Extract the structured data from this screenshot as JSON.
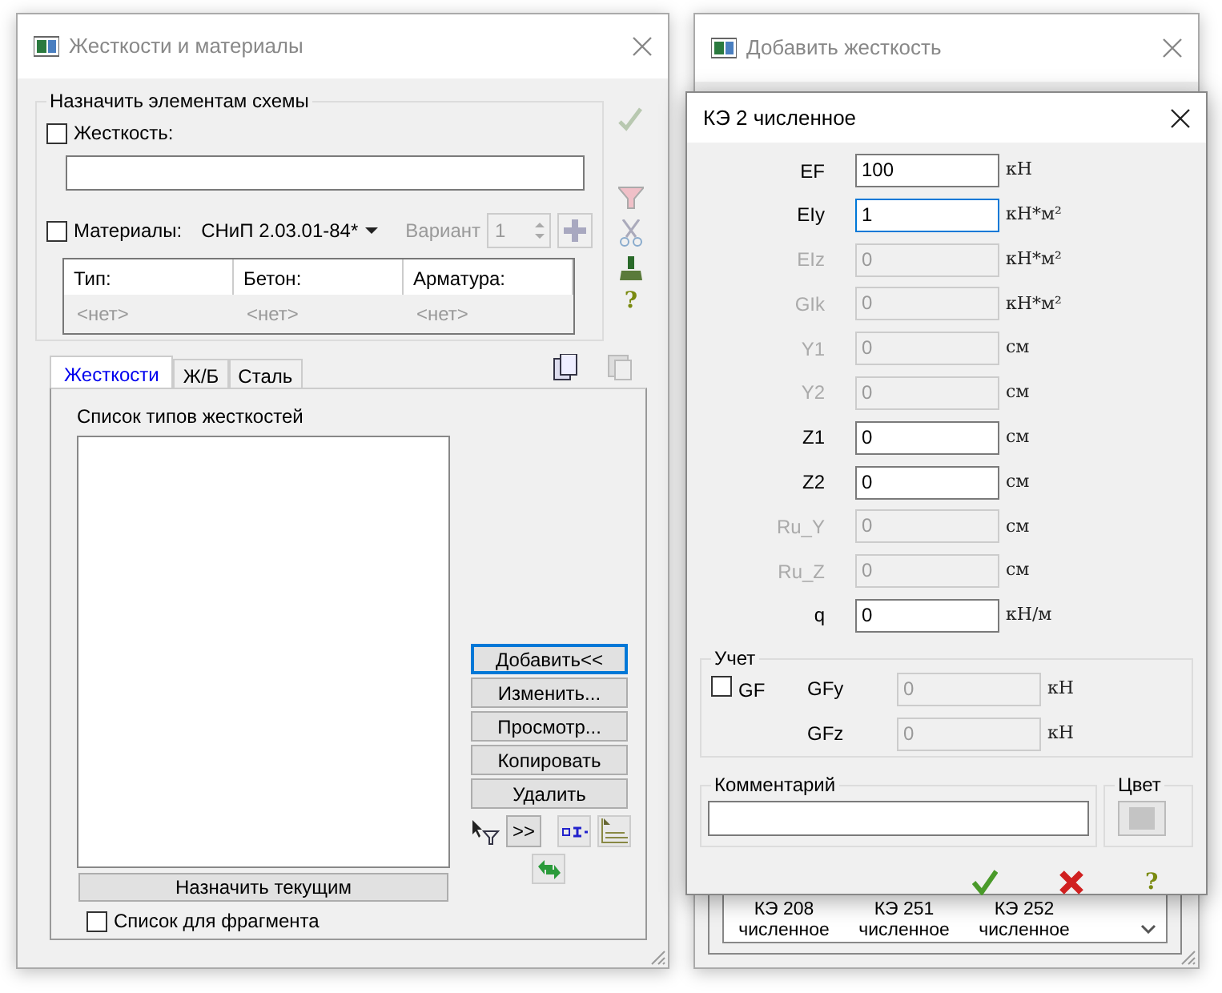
{
  "main_window": {
    "title": "Жесткости и материалы",
    "group": {
      "legend": "Назначить элементам схемы",
      "stiffness": {
        "label": "Жесткость:",
        "checked": false
      },
      "materials": {
        "label": "Материалы:",
        "checked": false,
        "norm": "СНиП 2.03.01-84*"
      },
      "variant": {
        "label": "Вариант",
        "value": "1"
      },
      "table": {
        "columns": [
          "Тип:",
          "Бетон:",
          "Арматура:"
        ],
        "rows": [
          [
            "<нет>",
            "<нет>",
            "<нет>"
          ]
        ]
      }
    },
    "help_glyph": "?",
    "tabs": [
      {
        "label": "Жесткости",
        "selected": true
      },
      {
        "label": "Ж/Б",
        "selected": false
      },
      {
        "label": "Сталь",
        "selected": false
      }
    ],
    "list_caption": "Список типов жесткостей",
    "buttons": [
      {
        "label": "Добавить<<",
        "focused": true
      },
      {
        "label": "Изменить...",
        "focused": false
      },
      {
        "label": "Просмотр...",
        "focused": false
      },
      {
        "label": "Копировать",
        "focused": false
      },
      {
        "label": "Удалить",
        "focused": false
      }
    ],
    "move_button": ">>",
    "assign_button": "Назначить текущим",
    "fragment": {
      "label": "Список для фрагмента",
      "checked": false
    }
  },
  "back_window": {
    "title": "Добавить жесткость",
    "list_items": [
      {
        "line1": "КЭ 208",
        "line2": "численное"
      },
      {
        "line1": "КЭ 251",
        "line2": "численное"
      },
      {
        "line1": "КЭ 252",
        "line2": "численное"
      }
    ]
  },
  "dialog": {
    "title": "КЭ 2 численное",
    "fields": [
      {
        "label": "EF",
        "value": "100",
        "unit": "кН",
        "disabled": false,
        "focused": false
      },
      {
        "label": "EIy",
        "value": "1",
        "unit": "кН*м²",
        "disabled": false,
        "focused": true
      },
      {
        "label": "EIz",
        "value": "0",
        "unit": "кН*м²",
        "disabled": true,
        "focused": false
      },
      {
        "label": "GIk",
        "value": "0",
        "unit": "кН*м²",
        "disabled": true,
        "focused": false
      },
      {
        "label": "Y1",
        "value": "0",
        "unit": "см",
        "disabled": true,
        "focused": false
      },
      {
        "label": "Y2",
        "value": "0",
        "unit": "см",
        "disabled": true,
        "focused": false
      },
      {
        "label": "Z1",
        "value": "0",
        "unit": "см",
        "disabled": false,
        "focused": false
      },
      {
        "label": "Z2",
        "value": "0",
        "unit": "см",
        "disabled": false,
        "focused": false
      },
      {
        "label": "Ru_Y",
        "value": "0",
        "unit": "см",
        "disabled": true,
        "focused": false
      },
      {
        "label": "Ru_Z",
        "value": "0",
        "unit": "см",
        "disabled": true,
        "focused": false
      },
      {
        "label": "q",
        "value": "0",
        "unit": "кН/м",
        "disabled": false,
        "focused": false
      }
    ],
    "account": {
      "legend": "Учет",
      "gf": {
        "label": "GF",
        "checked": false
      },
      "fields": [
        {
          "label": "GFy",
          "value": "0",
          "unit": "кН",
          "disabled": true
        },
        {
          "label": "GFz",
          "value": "0",
          "unit": "кН",
          "disabled": true
        }
      ]
    },
    "comment": {
      "legend": "Комментарий"
    },
    "color": {
      "legend": "Цвет"
    },
    "help_glyph": "?"
  }
}
